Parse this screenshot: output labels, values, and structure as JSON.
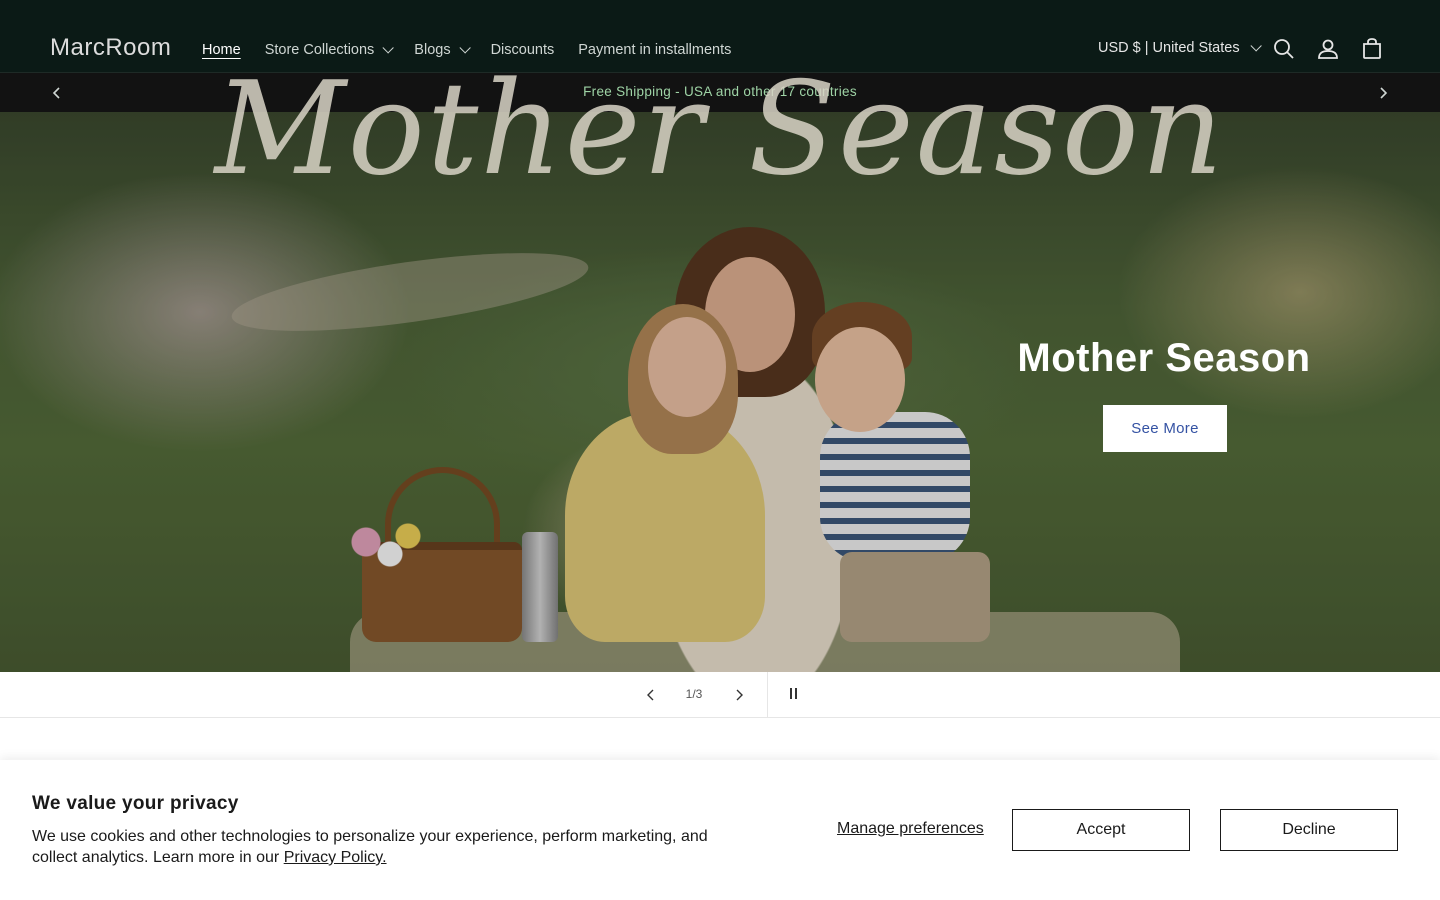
{
  "header": {
    "logo": "MarcRoom",
    "nav": [
      {
        "label": "Home",
        "active": true
      },
      {
        "label": "Store Collections",
        "dropdown": true
      },
      {
        "label": "Blogs",
        "dropdown": true
      },
      {
        "label": "Discounts"
      },
      {
        "label": "Payment in installments"
      }
    ],
    "locale": "USD $ | United States",
    "icons": [
      "search-icon",
      "account-icon",
      "cart-icon"
    ]
  },
  "announcement": {
    "text": "Free Shipping - USA and other 17 countries",
    "icons": [
      "chevron-left-icon",
      "chevron-right-icon"
    ]
  },
  "hero": {
    "image_text": "Mother Season",
    "title": "Mother Season",
    "button_label": "See More"
  },
  "slideshow": {
    "counter": "1/3",
    "icons": [
      "chevron-left-icon",
      "chevron-right-icon",
      "pause-icon"
    ]
  },
  "cookie_banner": {
    "title": "We value your privacy",
    "text": "We use cookies and other technologies to personalize your experience, perform marketing, and collect analytics. Learn more in our",
    "link": "Privacy Policy.",
    "manage_label": "Manage preferences",
    "accept_label": "Accept",
    "decline_label": "Decline"
  },
  "colors": {
    "header_bg": "#0b1a16",
    "announcement_bg": "#121212",
    "announcement_text": "#9fd4a6",
    "hero_button_text": "#3452a3"
  }
}
